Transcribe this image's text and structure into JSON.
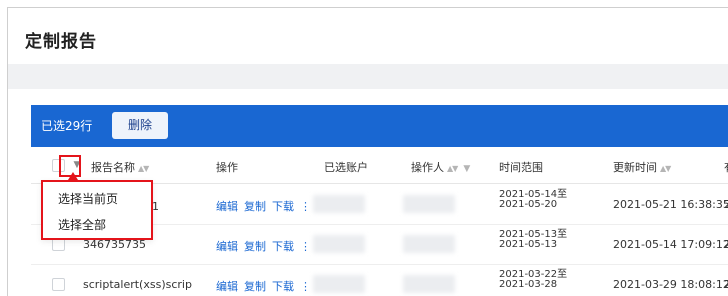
{
  "page": {
    "title": "定制报告"
  },
  "selection_bar": {
    "selected_text": "已选29行",
    "delete_label": "删除"
  },
  "table": {
    "columns": {
      "name": "报告名称",
      "ops": "操作",
      "accounts": "已选账户",
      "operator": "操作人",
      "range": "时间范围",
      "updated": "更新时间",
      "extra": "有"
    },
    "rows": [
      {
        "name": "测试11",
        "ops": [
          "编辑",
          "复制",
          "下载"
        ],
        "more": "⋮",
        "range_start": "2021-05-14至",
        "range_end": "2021-05-20",
        "updated": "2021-05-21 16:38:35",
        "edge": "2"
      },
      {
        "name": "346735735",
        "ops": [
          "编辑",
          "复制",
          "下载"
        ],
        "more": "⋮",
        "range_start": "2021-05-13至",
        "range_end": "2021-05-13",
        "updated": "2021-05-14 17:09:12",
        "edge": "2"
      },
      {
        "name": "scriptalert(xss)scrip",
        "ops": [
          "编辑",
          "复制",
          "下载"
        ],
        "more": "⋮",
        "range_start": "2021-03-22至",
        "range_end": "2021-03-28",
        "updated": "2021-03-29 18:08:12",
        "edge": "2"
      }
    ]
  },
  "dropdown": {
    "items": [
      "选择当前页",
      "选择全部"
    ]
  },
  "colors": {
    "primary": "#1967d2",
    "highlight": "#e4141b",
    "band": "#f0f1f3"
  },
  "icons": {
    "select_menu": "chevron-down-icon",
    "sort": "sort-icon",
    "filter": "filter-icon",
    "more": "more-vertical-icon"
  }
}
